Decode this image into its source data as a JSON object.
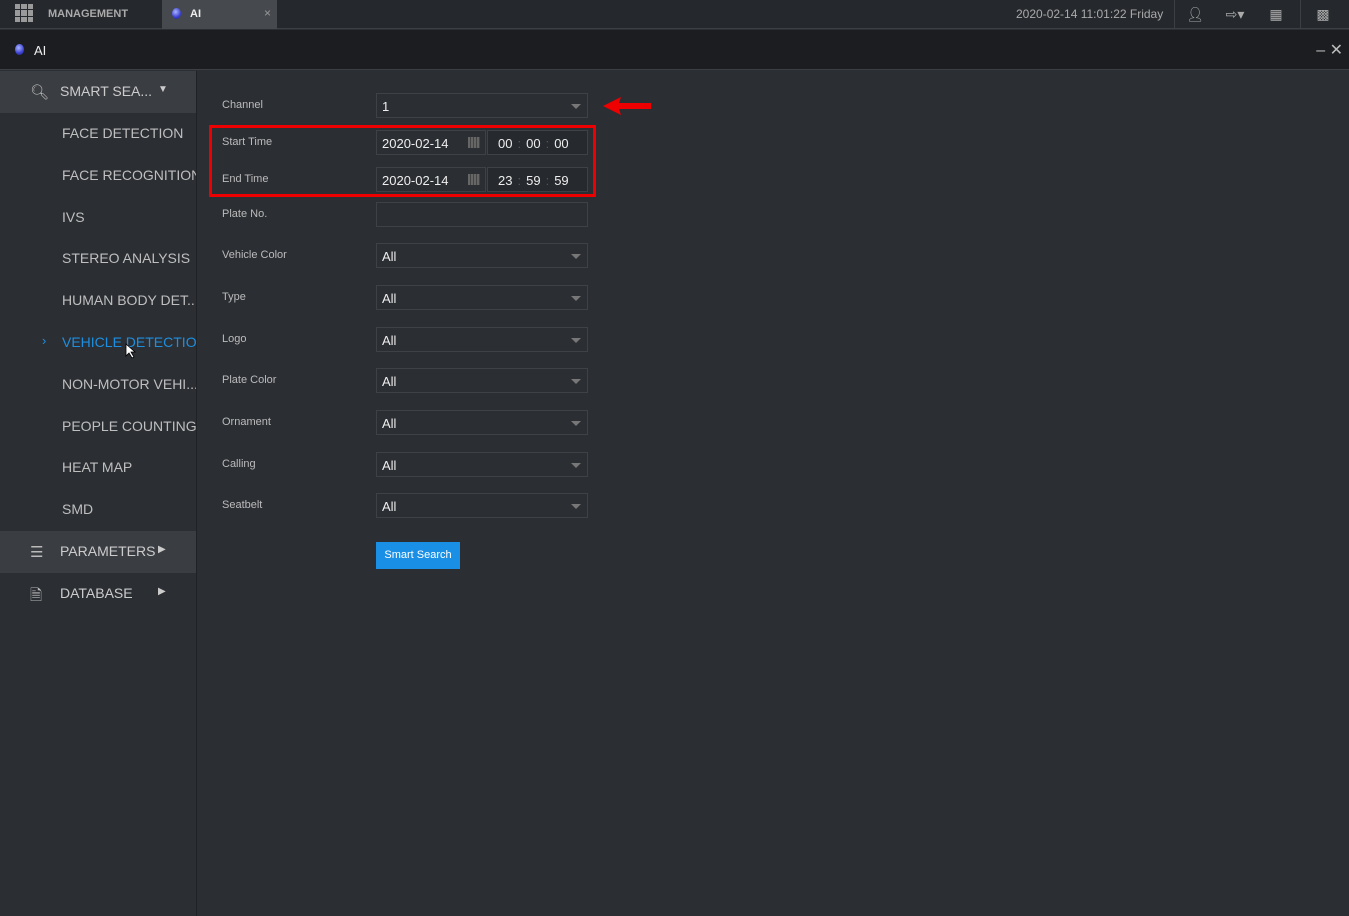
{
  "topbar": {
    "management_label": "MANAGEMENT",
    "tab_label": "AI",
    "close": "×",
    "datetime": "2020-02-14 11:01:22 Friday",
    "icons": [
      "user-icon",
      "logout-icon",
      "qr-code-icon",
      "monitor-icon"
    ]
  },
  "window": {
    "title": "AI",
    "minimize": "–",
    "close": "✕"
  },
  "sidebar": {
    "smart_search": "SMART SEA...",
    "items": [
      {
        "label": "FACE DETECTION"
      },
      {
        "label": "FACE RECOGNITION"
      },
      {
        "label": "IVS"
      },
      {
        "label": "STEREO ANALYSIS"
      },
      {
        "label": "HUMAN BODY DET..."
      },
      {
        "label": "VEHICLE DETECTION",
        "active": true
      },
      {
        "label": "NON-MOTOR VEHI..."
      },
      {
        "label": "PEOPLE COUNTING"
      },
      {
        "label": "HEAT MAP"
      },
      {
        "label": "SMD"
      }
    ],
    "parameters": "PARAMETERS",
    "database": "DATABASE",
    "active_color": "#1e8fe0"
  },
  "form": {
    "channel": {
      "label": "Channel",
      "value": "1"
    },
    "start_time": {
      "label": "Start Time",
      "date": "2020-02-14",
      "hh": "00",
      "mm": "00",
      "ss": "00"
    },
    "end_time": {
      "label": "End Time",
      "date": "2020-02-14",
      "hh": "23",
      "mm": "59",
      "ss": "59"
    },
    "plate_no": {
      "label": "Plate No.",
      "value": ""
    },
    "vehicle_color": {
      "label": "Vehicle Color",
      "value": "All"
    },
    "type": {
      "label": "Type",
      "value": "All"
    },
    "logo": {
      "label": "Logo",
      "value": "All"
    },
    "plate_color": {
      "label": "Plate Color",
      "value": "All"
    },
    "ornament": {
      "label": "Ornament",
      "value": "All"
    },
    "calling": {
      "label": "Calling",
      "value": "All"
    },
    "seatbelt": {
      "label": "Seatbelt",
      "value": "All"
    },
    "search_button": "Smart Search",
    "button_color": "#1a8fe6",
    "annotation_color": "#e00000"
  }
}
